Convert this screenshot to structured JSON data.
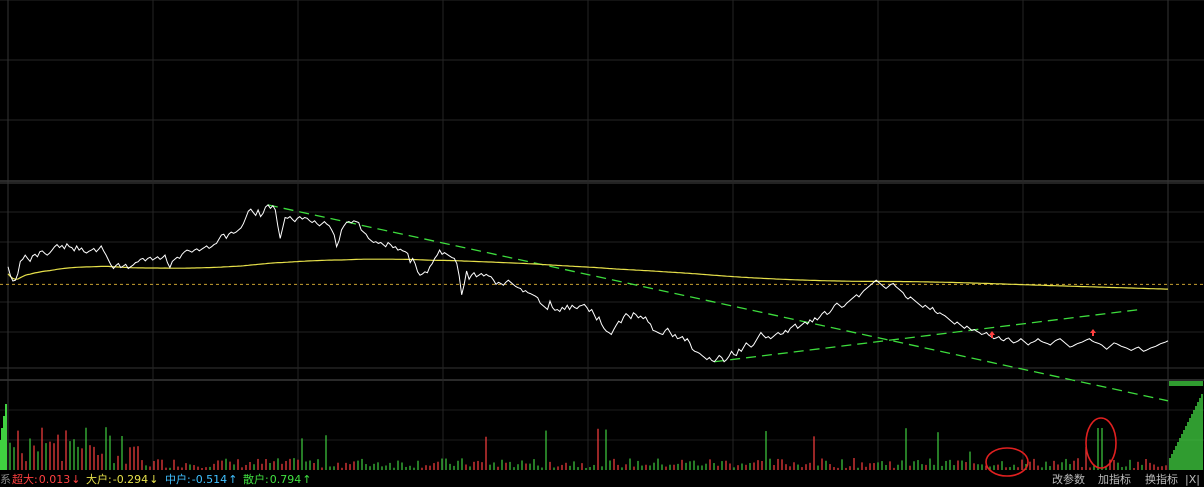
{
  "colors": {
    "price_line": "#ffffff",
    "avg_line": "#e6e04a",
    "ref_line": "#c8a030",
    "trend_line": "#3ddc3d",
    "up": "#ff4040",
    "down": "#40d040",
    "grid": "#2a2a2a",
    "annotation": "#e02020"
  },
  "icons": {
    "left_marker": "→",
    "corner": "-"
  },
  "status": {
    "left_glyph": "系",
    "super_large": {
      "label": "超大:",
      "value": "0.013",
      "arrow": "↓",
      "color": "#ff4040"
    },
    "large": {
      "label": "大户:",
      "value": "-0.294",
      "arrow": "↓",
      "color": "#e6e04a"
    },
    "medium": {
      "label": "中户:",
      "value": "-0.514",
      "arrow": "↑",
      "color": "#40c0ff"
    },
    "retail": {
      "label": "散户:",
      "value": "0.794",
      "arrow": "↑",
      "color": "#40e040"
    }
  },
  "buttons": {
    "change_params": "改参数",
    "add_indicator": "加指标",
    "switch_indicator": "换指标",
    "close": "|X|"
  },
  "chart_data": {
    "type": "line",
    "series": [
      {
        "values": [
          0.42,
          0.2,
          0.08,
          0.1,
          0.25,
          0.55,
          0.6,
          0.7,
          0.62,
          0.55,
          0.68,
          0.72,
          0.66,
          0.78,
          0.8,
          0.74,
          0.7,
          0.75,
          0.82,
          0.9,
          0.95,
          0.88,
          0.93,
          0.85,
          0.97,
          0.9,
          0.88,
          0.8,
          0.92,
          0.82,
          0.87,
          0.78,
          0.75,
          0.79,
          0.82,
          0.86,
          0.78,
          0.84,
          0.92,
          0.8,
          0.7,
          0.58,
          0.46,
          0.38,
          0.45,
          0.5,
          0.4,
          0.44,
          0.48,
          0.38,
          0.42,
          0.46,
          0.52,
          0.54,
          0.6,
          0.62,
          0.56,
          0.62,
          0.65,
          0.58,
          0.62,
          0.66,
          0.6,
          0.64,
          0.7,
          0.52,
          0.4,
          0.55,
          0.6,
          0.65,
          0.62,
          0.72,
          0.78,
          0.82,
          0.8,
          0.77,
          0.82,
          0.85,
          0.8,
          0.84,
          0.88,
          0.92,
          0.86,
          0.9,
          0.95,
          0.98,
          1.08,
          1.18,
          1.2,
          1.1,
          1.2,
          1.25,
          1.22,
          1.25,
          1.3,
          1.35,
          1.45,
          1.6,
          1.75,
          1.8,
          1.72,
          1.65,
          1.78,
          1.62,
          1.7,
          1.85,
          1.9,
          1.82,
          1.88,
          1.78,
          1.4,
          1.1,
          1.35,
          1.6,
          1.58,
          1.62,
          1.55,
          1.5,
          1.58,
          1.62,
          1.56,
          1.6,
          1.58,
          1.52,
          1.48,
          1.52,
          1.45,
          1.4,
          1.45,
          1.5,
          1.44,
          1.4,
          1.3,
          1.18,
          0.9,
          1.05,
          1.3,
          1.4,
          1.48,
          1.5,
          1.47,
          1.52,
          1.5,
          1.48,
          1.3,
          1.25,
          1.2,
          1.1,
          1.05,
          1.0,
          1.02,
          0.98,
          1.0,
          0.95,
          0.9,
          1.0,
          0.95,
          0.88,
          0.9,
          0.82,
          0.84,
          0.8,
          0.78,
          0.74,
          0.52,
          0.62,
          0.5,
          0.3,
          0.22,
          0.25,
          0.3,
          0.28,
          0.42,
          0.5,
          0.62,
          0.7,
          0.82,
          0.72,
          0.76,
          0.72,
          0.68,
          0.64,
          0.62,
          0.5,
          0.2,
          -0.25,
          0.0,
          0.32,
          0.12,
          0.22,
          0.28,
          0.18,
          0.22,
          0.26,
          0.2,
          0.24,
          0.2,
          0.18,
          0.1,
          0.0,
          0.05,
          0.02,
          -0.02,
          0.05,
          0.1,
          0.05,
          0.0,
          -0.05,
          -0.08,
          -0.1,
          -0.18,
          -0.15,
          -0.2,
          -0.22,
          -0.25,
          -0.28,
          -0.32,
          -0.45,
          -0.5,
          -0.55,
          -0.6,
          -0.4,
          -0.55,
          -0.62,
          -0.6,
          -0.65,
          -0.55,
          -0.6,
          -0.5,
          -0.6,
          -0.5,
          -0.55,
          -0.58,
          -0.52,
          -0.5,
          -0.48,
          -0.55,
          -0.65,
          -0.6,
          -0.72,
          -0.85,
          -0.78,
          -0.95,
          -1.05,
          -1.12,
          -1.15,
          -1.2,
          -1.08,
          -0.98,
          -0.88,
          -0.92,
          -0.78,
          -0.7,
          -0.75,
          -0.82,
          -0.68,
          -0.72,
          -0.8,
          -0.76,
          -0.82,
          -0.78,
          -0.9,
          -0.95,
          -1.1,
          -1.12,
          -1.15,
          -1.18,
          -1.2,
          -1.1,
          -1.05,
          -1.15,
          -1.25,
          -1.2,
          -1.3,
          -1.28,
          -1.25,
          -1.35,
          -1.3,
          -1.4,
          -1.55,
          -1.6,
          -1.62,
          -1.65,
          -1.7,
          -1.75,
          -1.8,
          -1.75,
          -1.82,
          -1.85,
          -1.78,
          -1.7,
          -1.75,
          -1.85,
          -1.8,
          -1.72,
          -1.6,
          -1.68,
          -1.7,
          -1.55,
          -1.6,
          -1.5,
          -1.4,
          -1.45,
          -1.5,
          -1.45,
          -1.35,
          -1.25,
          -1.15,
          -1.22,
          -1.28,
          -1.25,
          -1.3,
          -1.25,
          -1.2,
          -1.15,
          -1.2,
          -1.18,
          -1.1,
          -1.15,
          -1.05,
          -1.0,
          -0.95,
          -1.05,
          -1.0,
          -0.95,
          -0.9,
          -0.95,
          -0.85,
          -0.9,
          -0.8,
          -0.85,
          -0.78,
          -0.7,
          -0.65,
          -0.72,
          -0.68,
          -0.6,
          -0.5,
          -0.45,
          -0.5,
          -0.55,
          -0.52,
          -0.45,
          -0.4,
          -0.35,
          -0.3,
          -0.25,
          -0.3,
          -0.22,
          -0.15,
          -0.1,
          -0.05,
          0.0,
          0.05,
          0.1,
          0.05,
          0.0,
          -0.05,
          -0.1,
          -0.05,
          0.0,
          0.02,
          -0.05,
          -0.1,
          -0.15,
          -0.2,
          -0.3,
          -0.35,
          -0.3,
          -0.35,
          -0.4,
          -0.45,
          -0.5,
          -0.55,
          -0.5,
          -0.55,
          -0.6,
          -0.55,
          -0.65,
          -0.7,
          -0.68,
          -0.72,
          -0.75,
          -0.8,
          -0.85,
          -0.9,
          -0.95,
          -0.9,
          -0.95,
          -1.0,
          -1.05,
          -1.0,
          -1.05,
          -1.1,
          -1.08,
          -1.12,
          -1.15,
          -1.2,
          -1.18,
          -1.15,
          -1.22,
          -1.25,
          -1.3,
          -1.28,
          -1.25,
          -1.32,
          -1.35,
          -1.3,
          -1.28,
          -1.35,
          -1.4,
          -1.38,
          -1.35,
          -1.3,
          -1.35,
          -1.4,
          -1.45,
          -1.4,
          -1.38,
          -1.35,
          -1.3,
          -1.35,
          -1.38,
          -1.4,
          -1.42,
          -1.45,
          -1.4,
          -1.35,
          -1.32,
          -1.3,
          -1.35,
          -1.4,
          -1.45,
          -1.5,
          -1.48,
          -1.45,
          -1.42,
          -1.4,
          -1.38,
          -1.35,
          -1.32,
          -1.3,
          -1.35,
          -1.38,
          -1.4,
          -1.42,
          -1.45,
          -1.5,
          -1.55,
          -1.5,
          -1.45,
          -1.4,
          -1.42,
          -1.45,
          -1.48,
          -1.5,
          -1.52,
          -1.55,
          -1.58,
          -1.55,
          -1.52,
          -1.5,
          -1.55,
          -1.6,
          -1.58,
          -1.55,
          -1.52,
          -1.5,
          -1.48,
          -1.45,
          -1.42,
          -1.4,
          -1.38,
          -1.35
        ]
      }
    ],
    "ylim": [
      -2,
      2.4
    ]
  }
}
